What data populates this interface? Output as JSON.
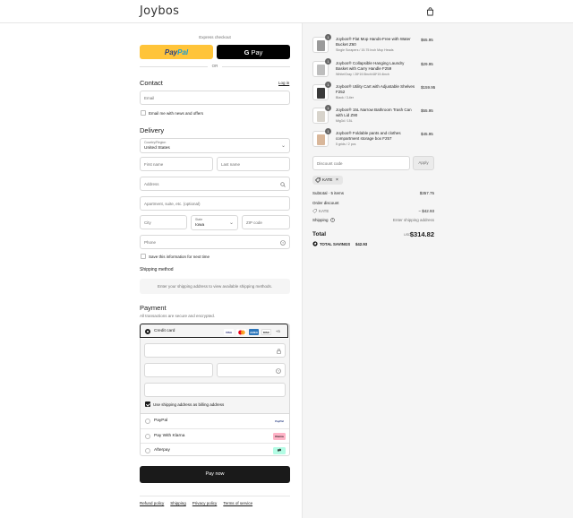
{
  "header": {
    "brand": "Joybos"
  },
  "express": {
    "label": "Express checkout",
    "paypal_pay": "Pay",
    "paypal_pal": "Pal",
    "gpay_g": "G",
    "gpay_label": "Pay",
    "or": "OR"
  },
  "contact": {
    "title": "Contact",
    "login": "Log in",
    "email_placeholder": "Email",
    "news_label": "Email me with news and offers"
  },
  "delivery": {
    "title": "Delivery",
    "country_label": "Country/Region",
    "country_value": "United States",
    "first_name": "First name",
    "last_name": "Last name",
    "address": "Address",
    "apartment": "Apartment, suite, etc. (optional)",
    "city": "City",
    "state_label": "State",
    "state_value": "Iowa",
    "zip": "ZIP code",
    "phone": "Phone",
    "save_info": "Save this information for next time"
  },
  "shipping_method": {
    "title": "Shipping method",
    "message": "Enter your shipping address to view available shipping methods."
  },
  "payment": {
    "title": "Payment",
    "subtitle": "All transactions are secure and encrypted.",
    "credit_card": "Credit card",
    "cards": [
      "VISA",
      "MC",
      "AMEX",
      "DISC"
    ],
    "more_cards": "+3",
    "billing_same": "Use shipping address as billing address",
    "methods": [
      {
        "label": "PayPal",
        "badge": "PayPal"
      },
      {
        "label": "Pay With Klarna",
        "badge": "Klarna"
      },
      {
        "label": "Afterpay",
        "badge": "⇄"
      }
    ],
    "pay_now": "Pay now"
  },
  "footer": {
    "links": [
      "Refund policy",
      "Shipping",
      "Privacy policy",
      "Terms of service"
    ]
  },
  "order": {
    "items": [
      {
        "qty": "1",
        "name": "Joybos® Flat Mop Hands-Free with Water Bucket Z60",
        "variant": "Single Scrapers / 15.75 Inch Mop Heads",
        "price": "$65.95"
      },
      {
        "qty": "1",
        "name": "Joybos® Collapsible Hanging Laundry Basket with Carry Handle F259",
        "variant": "White/Gray / 28*19.5inch/48*19.4inch",
        "price": "$29.95"
      },
      {
        "qty": "1",
        "name": "Joybos® Utility Cart with Adjustable Shelves F252",
        "variant": "Black / 3-tier",
        "price": "$159.95"
      },
      {
        "qty": "1",
        "name": "Joybos® 15L Narrow Bathroom Trash Can with Lid Z90",
        "variant": "Mig3d / 15L",
        "price": "$55.95"
      },
      {
        "qty": "1",
        "name": "Joybos® Foldable pants and clothes compartment storage box F257",
        "variant": "5 grids / 2 pcs",
        "price": "$45.95"
      }
    ],
    "discount_placeholder": "Discount code",
    "apply": "Apply",
    "code": "KATE",
    "subtotal_label": "Subtotal · 5 items",
    "subtotal_value": "$357.75",
    "order_discount_label": "Order discount",
    "discount_code": "KATE",
    "discount_value": "− $42.93",
    "shipping_label": "Shipping",
    "shipping_value": "Enter shipping address",
    "total_label": "Total",
    "currency": "USD",
    "total_value": "$314.82",
    "savings_label": "TOTAL SAVINGS",
    "savings_value": "$42.93"
  }
}
